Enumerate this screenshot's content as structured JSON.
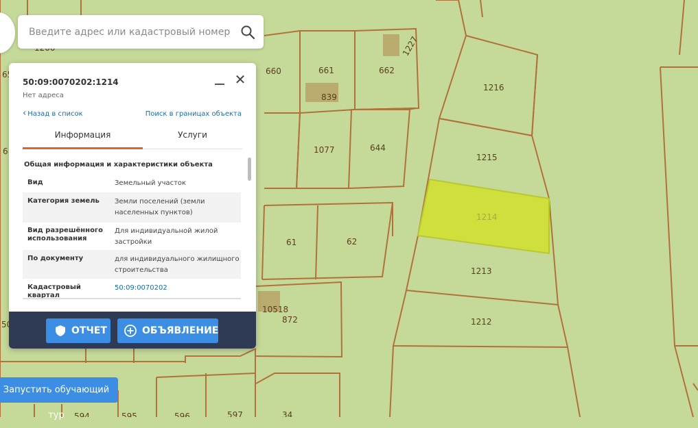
{
  "colors": {
    "map_background": "#c5d998",
    "parcel_border": "#b2713a",
    "selected_parcel_fill": "#cfe03d",
    "accent_tab": "#e0622d",
    "button_blue": "#3b8ee3",
    "footer_bg": "#2f3b54",
    "link_color": "#1a6ba8"
  },
  "search": {
    "placeholder": "Введите адрес или кадастровый номер",
    "icon": "search-icon"
  },
  "map": {
    "parcel_labels": [
      "1200",
      "660",
      "661",
      "662",
      "1227",
      "839",
      "1216",
      "1215",
      "1077",
      "644",
      "1214",
      "61",
      "62",
      "1213",
      "10518",
      "872",
      "1212",
      "594",
      "595",
      "596",
      "597",
      "34",
      "50",
      "6",
      "65"
    ],
    "selected_parcel": "1214"
  },
  "panel": {
    "cadastral_number": "50:09:0070202:1214",
    "address": "Нет адреса",
    "back_link": "Назад в список",
    "bounds_link": "Поиск в границах объекта",
    "tabs": [
      "Информация",
      "Услуги"
    ],
    "active_tab": "Информация",
    "section_title": "Общая информация и характеристики объекта",
    "rows": [
      {
        "key": "Вид",
        "value": "Земельный участок"
      },
      {
        "key": "Категория земель",
        "value": "Земли поселений (земли населенных пунктов)"
      },
      {
        "key": "Вид разрешённого использования",
        "value": "Для индивидуальной жилой застройки"
      },
      {
        "key": "По документу",
        "value": "для индивидуального жилищного строительства"
      },
      {
        "key": "Кадастровый квартал",
        "value": "50:09:0070202"
      }
    ],
    "buttons": {
      "report": "ОТЧЕТ",
      "ad": "ОБЪЯВЛЕНИЕ"
    }
  },
  "tour_button": "Запустить обучающий тур"
}
